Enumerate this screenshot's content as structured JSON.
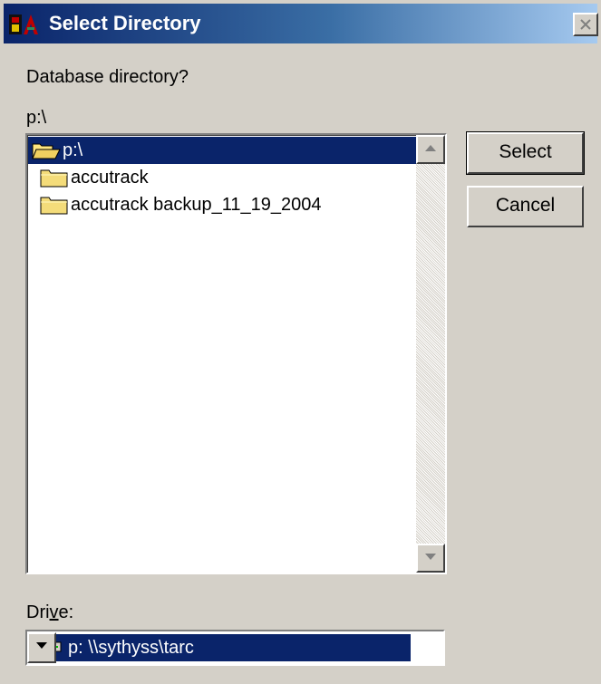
{
  "window": {
    "title": "Select Directory"
  },
  "prompt": "Database directory?",
  "current_path": "p:\\",
  "directory_list": {
    "items": [
      {
        "label": "p:\\",
        "icon": "open-folder-icon",
        "selected": true
      },
      {
        "label": "accutrack",
        "icon": "folder-icon",
        "selected": false
      },
      {
        "label": "accutrack backup_11_19_2004",
        "icon": "folder-icon",
        "selected": false
      }
    ]
  },
  "buttons": {
    "select_label": "Select",
    "cancel_label": "Cancel"
  },
  "drive": {
    "label_pre": "Dri",
    "label_accel": "v",
    "label_post": "e:",
    "selected_value": "p: \\\\sythyss\\tarc",
    "icon": "network-drive-icon"
  },
  "colors": {
    "face": "#d4d0c8",
    "selection": "#0a246a",
    "title_gradient_start": "#0a246a",
    "title_gradient_end": "#a6caf0"
  }
}
